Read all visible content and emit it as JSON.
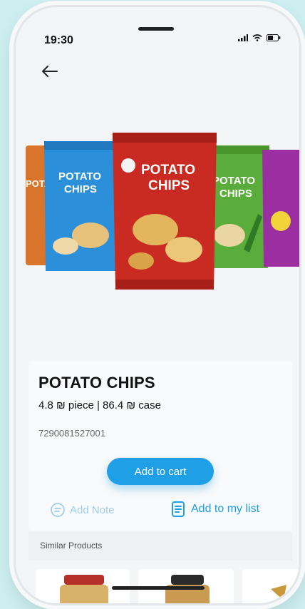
{
  "status": {
    "time": "19:30"
  },
  "nav": {
    "back_icon": "arrow-left-icon"
  },
  "product": {
    "title": "POTATO CHIPS",
    "price": "4.8 ₪ piece | 86.4 ₪ case",
    "barcode": "7290081527001",
    "add_to_cart": "Add to cart",
    "add_note": "Add Note",
    "add_to_list": "Add to my list",
    "image_text": {
      "line1": "POTATO",
      "line2": "CHIPS"
    }
  },
  "similar": {
    "label": "Similar Products"
  },
  "colors": {
    "accent": "#1e9fe6",
    "background": "#cdeff0"
  }
}
